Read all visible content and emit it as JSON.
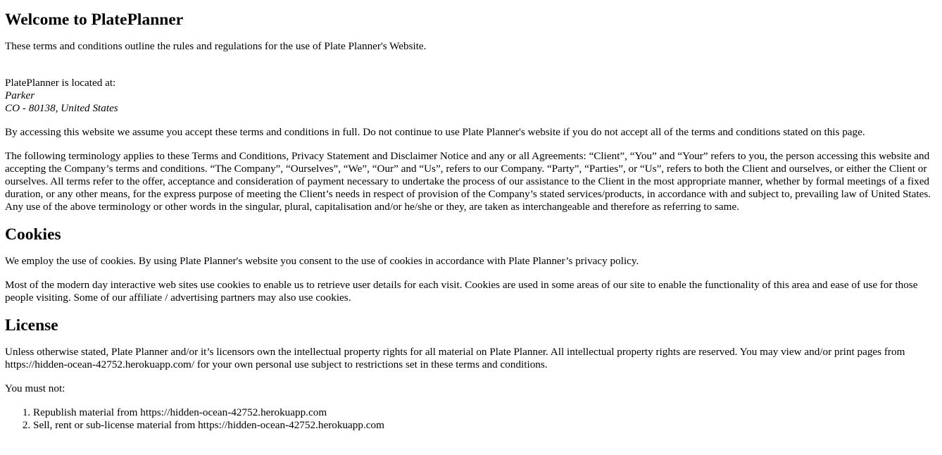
{
  "title": "Welcome to PlatePlanner",
  "intro": "These terms and conditions outline the rules and regulations for the use of Plate Planner's Website.",
  "location": {
    "label": "PlatePlanner is located at:",
    "city": "Parker",
    "region": "CO - 80138, United States"
  },
  "acceptance": "By accessing this website we assume you accept these terms and conditions in full. Do not continue to use Plate Planner's website if you do not accept all of the terms and conditions stated on this page.",
  "terminology": "The following terminology applies to these Terms and Conditions, Privacy Statement and Disclaimer Notice and any or all Agreements: “Client”, “You” and “Your” refers to you, the person accessing this website and accepting the Company’s terms and conditions. “The Company”, “Ourselves”, “We”, “Our” and “Us”, refers to our Company. “Party”, “Parties”, or “Us”, refers to both the Client and ourselves, or either the Client or ourselves. All terms refer to the offer, acceptance and consideration of payment necessary to undertake the process of our assistance to the Client in the most appropriate manner, whether by formal meetings of a fixed duration, or any other means, for the express purpose of meeting the Client’s needs in respect of provision of the Company’s stated services/products, in accordance with and subject to, prevailing law of United States. Any use of the above terminology or other words in the singular, plural, capitalisation and/or he/she or they, are taken as interchangeable and therefore as referring to same.",
  "cookies": {
    "heading": "Cookies",
    "p1": "We employ the use of cookies. By using Plate Planner's website you consent to the use of cookies in accordance with Plate Planner’s privacy policy.",
    "p2": "Most of the modern day interactive web sites use cookies to enable us to retrieve user details for each visit. Cookies are used in some areas of our site to enable the functionality of this area and ease of use for those people visiting. Some of our affiliate / advertising partners may also use cookies."
  },
  "license": {
    "heading": "License",
    "p1": "Unless otherwise stated, Plate Planner and/or it’s licensors own the intellectual property rights for all material on Plate Planner. All intellectual property rights are reserved. You may view and/or print pages from https://hidden-ocean-42752.herokuapp.com/ for your own personal use subject to restrictions set in these terms and conditions.",
    "must_not": "You must not:",
    "items": [
      "Republish material from https://hidden-ocean-42752.herokuapp.com",
      "Sell, rent or sub-license material from https://hidden-ocean-42752.herokuapp.com"
    ]
  }
}
